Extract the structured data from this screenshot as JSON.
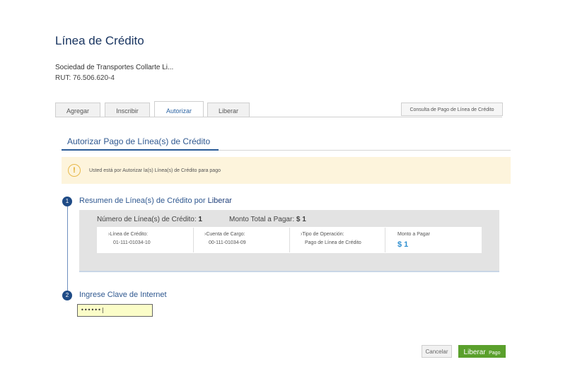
{
  "header": {
    "title": "Línea de Crédito",
    "company": "Sociedad de Transportes Collarte Li...",
    "rut": "RUT: 76.506.620-4"
  },
  "tabs": [
    {
      "label": "Agregar",
      "active": false
    },
    {
      "label": "Inscribir",
      "active": false
    },
    {
      "label": "Autorizar",
      "active": true
    },
    {
      "label": "Liberar",
      "active": false
    }
  ],
  "consulta_button": "Consulta de Pago de Línea de Crédito",
  "section": {
    "title": "Autorizar Pago de Línea(s) de Crédito"
  },
  "alert": {
    "icon": "exclamation-icon",
    "text": "Usted está por Autorizar la(s) Línea(s) de Crédito para pago"
  },
  "step1": {
    "number": "1",
    "title": "Resumen de Línea(s) de Crédito por",
    "link": "Liberar",
    "count_label": "Número de Línea(s) de Crédito:",
    "count_value": "1",
    "total_label": "Monto Total a Pagar:",
    "total_value": "$ 1",
    "columns": [
      {
        "label": "Línea de Crédito:",
        "value": "01-111-01034-10"
      },
      {
        "label": "Cuenta de Cargo:",
        "value": "00-111-01034-09"
      },
      {
        "label": "Tipo de Operación:",
        "value": "Pago de Línea de Crédito"
      },
      {
        "label": "Monto a Pagar",
        "value": "$ 1"
      }
    ]
  },
  "step2": {
    "number": "2",
    "title": "Ingrese Clave de Internet",
    "password_value": "••••••|"
  },
  "buttons": {
    "cancel": "Cancelar",
    "primary_big": "Liberar",
    "primary_small": "Pago"
  },
  "colors": {
    "primary": "#5aa02c",
    "accent": "#2a5b97",
    "alert_bg": "#fdf4dc"
  }
}
